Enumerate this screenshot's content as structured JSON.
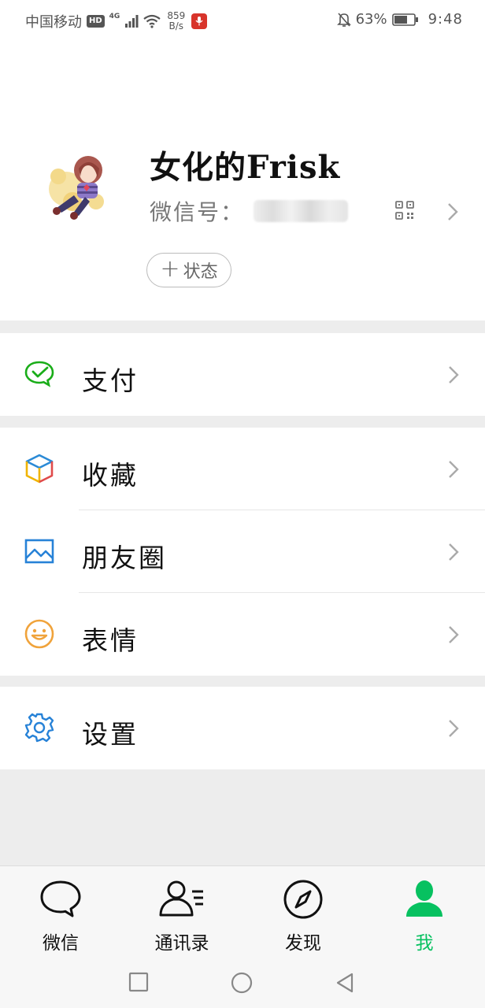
{
  "status_bar": {
    "carrier": "中国移动",
    "hd_badge": "HD",
    "network_type": "4G",
    "speed_value": "859",
    "speed_unit": "B/s",
    "battery_percent": "63%",
    "time": "9:48",
    "icons": [
      "signal-icon",
      "wifi-icon",
      "mic-record-icon",
      "bell-off-icon",
      "battery-icon"
    ]
  },
  "profile": {
    "nickname": "女化的Frisk",
    "wechat_id_label": "微信号：",
    "status_button_plus": "+",
    "status_button_label": "状态"
  },
  "menu": {
    "pay": {
      "label": "支付",
      "icon": "wechat-pay-icon"
    },
    "favorites": {
      "label": "收藏",
      "icon": "favorites-cube-icon"
    },
    "moments": {
      "label": "朋友圈",
      "icon": "moments-picture-icon"
    },
    "stickers": {
      "label": "表情",
      "icon": "sticker-smiley-icon"
    },
    "settings": {
      "label": "设置",
      "icon": "settings-gear-icon"
    }
  },
  "tabs": [
    {
      "label": "微信",
      "icon": "chat-bubble-icon",
      "active": false
    },
    {
      "label": "通讯录",
      "icon": "contacts-icon",
      "active": false
    },
    {
      "label": "发现",
      "icon": "compass-icon",
      "active": false
    },
    {
      "label": "我",
      "icon": "me-person-icon",
      "active": true
    }
  ],
  "colors": {
    "accent_green": "#07c160",
    "background": "#ededed",
    "pay_green": "#1aad19",
    "moments_blue": "#2782d7",
    "sticker_orange": "#f0a33b",
    "settings_blue": "#2782d7",
    "record_red": "#d8342b"
  }
}
